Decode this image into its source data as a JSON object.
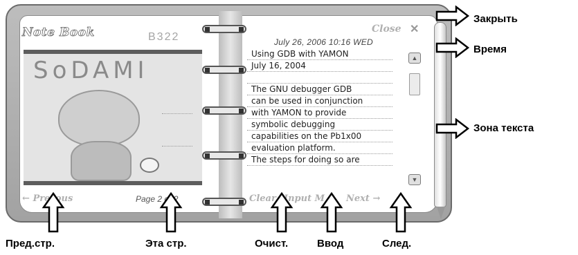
{
  "notebook": {
    "title": "Note Book",
    "code": "B322",
    "close_label": "Close",
    "close_icon": "close-x-icon",
    "datetime": "July 26, 2006 10:16 WED",
    "text_lines": [
      "Using GDB with YAMON",
      "July 16, 2004",
      "",
      "The GNU debugger GDB",
      "can be used in conjunction",
      "with YAMON to provide",
      "symbolic debugging",
      "capabilities on the Pb1x00",
      "evaluation platform.",
      "The steps for doing so are"
    ],
    "picture_logo": "SoDAMI",
    "prev_label": "Prevous",
    "page_label": "Page 2 of 2",
    "clear_label": "Clear",
    "input_label": "Input",
    "input_suffix": "M",
    "next_label": "Next"
  },
  "callouts": {
    "close": "Закрыть",
    "time": "Время",
    "text_zone": "Зона текста",
    "prev_page": "Пред.стр.",
    "this_page": "Эта стр.",
    "clear": "Очист.",
    "input": "Ввод",
    "next": "След."
  }
}
